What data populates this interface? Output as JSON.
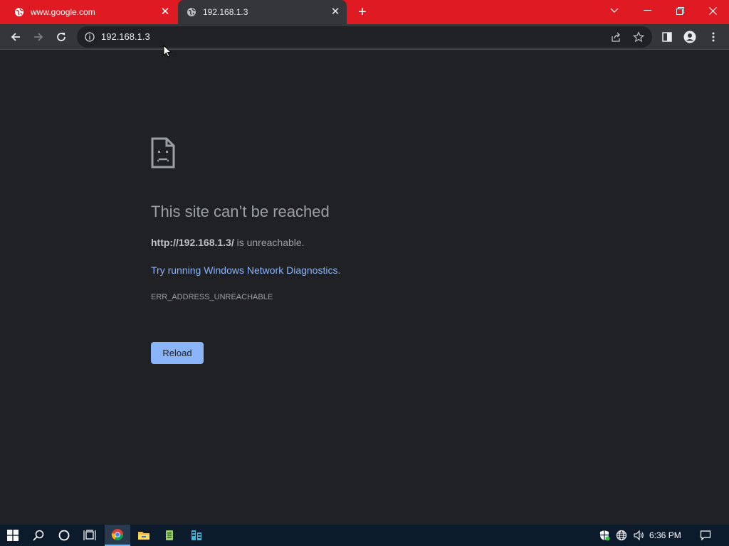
{
  "tabs": [
    {
      "label": "www.google.com",
      "icon": "globe-icon"
    },
    {
      "label": "192.168.1.3",
      "icon": "globe-icon",
      "active": true
    }
  ],
  "address_bar": {
    "url": "192.168.1.3"
  },
  "error": {
    "title": "This site can’t be reached",
    "url_bold": "http://192.168.1.3/",
    "url_suffix": " is unreachable.",
    "link_prefix": "Try running ",
    "link_text": "Windows Network Diagnostics",
    "link_suffix": ".",
    "code": "ERR_ADDRESS_UNREACHABLE",
    "button_label": "Reload"
  },
  "taskbar": {
    "time": "6:36 PM"
  },
  "colors": {
    "titlebar": "#e01a22",
    "toolbar": "#35363a",
    "page_bg": "#202124",
    "link": "#8ab4f8",
    "button_bg": "#8ab4f8"
  }
}
